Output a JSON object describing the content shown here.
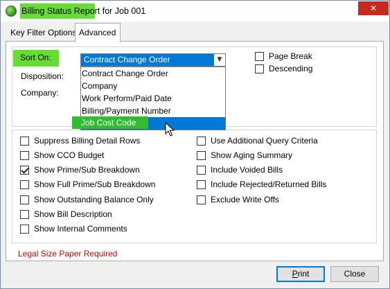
{
  "window": {
    "title": "Billing Status Report for Job 001",
    "close_glyph": "✕"
  },
  "tabs": [
    {
      "label": "Key Filter Options",
      "active": false
    },
    {
      "label": "Advanced",
      "active": true
    }
  ],
  "sort": {
    "label": "Sort On:",
    "selected": "Contract Change Order",
    "options": [
      "Contract Change Order",
      "Company",
      "Work Perform/Paid Date",
      "Billing/Payment Number",
      "Job Cost Code"
    ],
    "hovered": "Job Cost Code"
  },
  "fields": {
    "disposition_label": "Disposition:",
    "company_label": "Company:"
  },
  "top_options": [
    {
      "label": "Page Break",
      "checked": false
    },
    {
      "label": "Descending",
      "checked": false
    }
  ],
  "left_options": [
    {
      "label": "Suppress Billing Detail Rows",
      "checked": false
    },
    {
      "label": "Show CCO Budget",
      "checked": false
    },
    {
      "label": "Show Prime/Sub Breakdown",
      "checked": true
    },
    {
      "label": "Show Full Prime/Sub Breakdown",
      "checked": false
    },
    {
      "label": "Show Outstanding Balance Only",
      "checked": false
    },
    {
      "label": "Show Bill Description",
      "checked": false
    },
    {
      "label": "Show Internal Comments",
      "checked": false
    }
  ],
  "right_options": [
    {
      "label": "Use Additional Query Criteria",
      "checked": false
    },
    {
      "label": "Show Aging Summary",
      "checked": false
    },
    {
      "label": "Include Voided Bills",
      "checked": false
    },
    {
      "label": "Include Rejected/Returned Bills",
      "checked": false
    },
    {
      "label": "Exclude Write Offs",
      "checked": false
    }
  ],
  "notice": "Legal Size Paper Required",
  "buttons": {
    "print": {
      "first": "P",
      "rest": "rint"
    },
    "close": "Close"
  },
  "colors": {
    "accent": "#0078d7",
    "highlight": "#66dd33",
    "notice": "#d40000",
    "close_button": "#c42b1c"
  }
}
